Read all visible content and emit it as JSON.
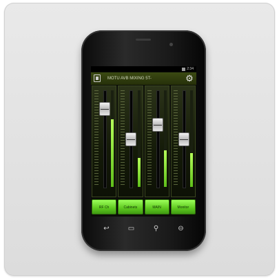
{
  "app": {
    "title": "MOTU AVB MIXING 5T-",
    "status_time": "2:34"
  },
  "channels": [
    {
      "label": "RF Ch",
      "fader_level": 0.86,
      "meter_level": 0.7
    },
    {
      "label": "Cabinets",
      "fader_level": 0.49,
      "meter_level": 0.3
    },
    {
      "label": "MAIN",
      "fader_level": 0.67,
      "meter_level": 0.38
    },
    {
      "label": "Monitor",
      "fader_level": 0.49,
      "meter_level": 0.35
    }
  ],
  "icons": {
    "speaker": "speaker-icon",
    "settings": "gear-icon",
    "nav": [
      "back-icon",
      "home-icon",
      "search-icon",
      "menu-icon"
    ]
  },
  "colors": {
    "accent_green": "#5ec81f",
    "titlebar": "#3b4a12",
    "phone_body": "#1a1a1a"
  }
}
